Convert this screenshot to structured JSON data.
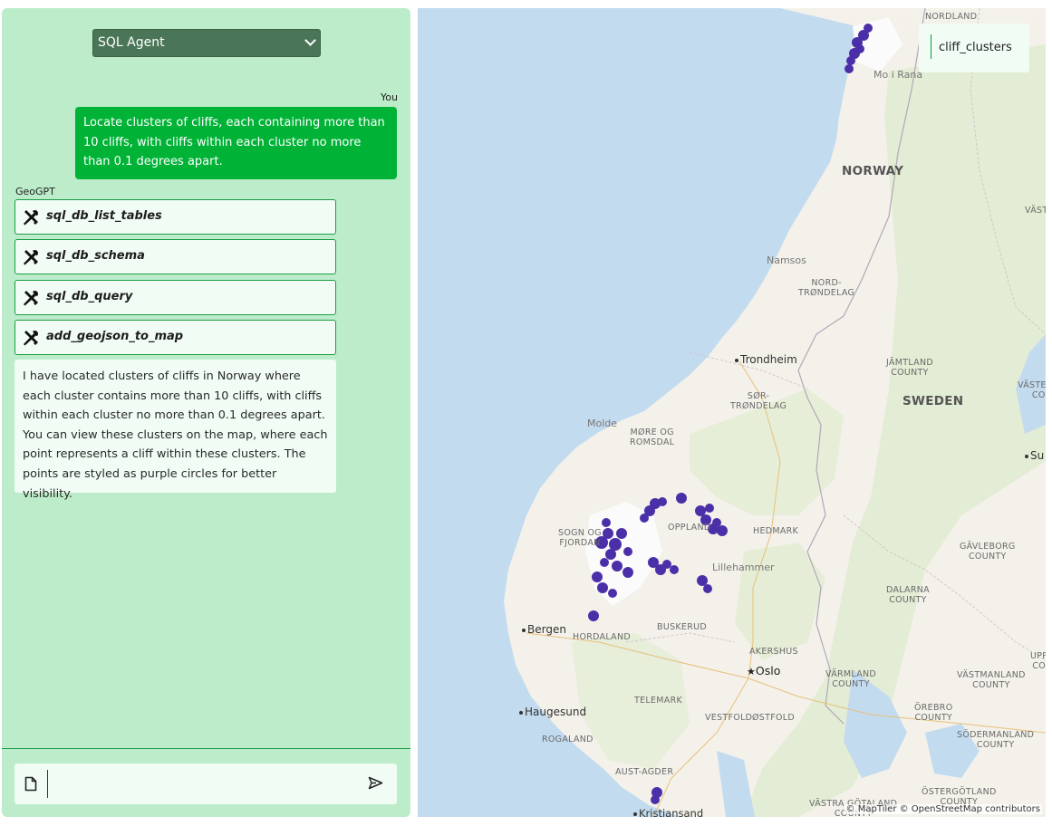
{
  "agent_select": {
    "value": "SQL Agent"
  },
  "conversation": {
    "user_label": "You",
    "user_message": "Locate clusters of cliffs, each containing more than 10 cliffs, with cliffs within each cluster no more than 0.1 degrees apart.",
    "assistant_label": "GeoGPT",
    "tool_calls": [
      "sql_db_list_tables",
      "sql_db_schema",
      "sql_db_query",
      "add_geojson_to_map"
    ],
    "assistant_message": "I have located clusters of cliffs in Norway where each cluster contains more than 10 cliffs, with cliffs within each cluster no more than 0.1 degrees apart. You can view these clusters on the map, where each point represents a cliff within these clusters. The points are styled as purple circles for better visibility."
  },
  "input": {
    "value": "",
    "file_icon": "file-icon",
    "send_icon": "send-icon"
  },
  "map": {
    "layer_legend": "cliff_clusters",
    "attribution": "© MapTiler © OpenStreetMap contributors",
    "cluster_color": "#4b2fa8",
    "labels": {
      "nordland": "NORDLAND",
      "mo_i_rana": "Mo i Rana",
      "norway": "NORWAY",
      "vast": "VÄST",
      "namsos": "Namsos",
      "nord_trondelag": "NORD-\nTRØNDELAG",
      "trondheim": "Trondheim",
      "jamtland": "JÄMTLAND\nCOUNTY",
      "vasternorr": "VÄSTERNO\nCOU",
      "sor_trondelag": "SØR-\nTRØNDELAG",
      "sweden": "SWEDEN",
      "molde": "Molde",
      "more_romsdal": "MØRE OG\nROMSDAL",
      "su": "Su",
      "sogn": "SOGN OG\nFJORDAN",
      "oppland": "OPPLAND",
      "hedmark": "HEDMARK",
      "gavleborg": "GÄVLEBORG\nCOUNTY",
      "lillehammer": "Lillehammer",
      "dalarna": "DALARNA\nCOUNTY",
      "bergen": "Bergen",
      "hordaland": "HORDALAND",
      "buskerud": "BUSKERUD",
      "akershus": "AKERSHUS",
      "upp": "UPP\nCO",
      "oslo": "Oslo",
      "varmland": "VÄRMLAND\nCOUNTY",
      "vastmanland": "VÄSTMANLAND\nCOUNTY",
      "telemark": "TELEMARK",
      "haugesund": "Haugesund",
      "orebro": "ÖREBRO\nCOUNTY",
      "vestfold": "VESTFOLD",
      "ostfold": "ØSTFOLD",
      "rogaland": "ROGALAND",
      "sodermanland": "SÖDERMANLAND\nCOUNTY",
      "aust_agder": "AUST-AGDER",
      "ostergotland": "ÖSTERGÖTLAND\nCOUNTY",
      "vastra_got": "VÄSTRA GÖTALAND\nCOUNTY",
      "kristiansand": "Kristiansand"
    }
  }
}
